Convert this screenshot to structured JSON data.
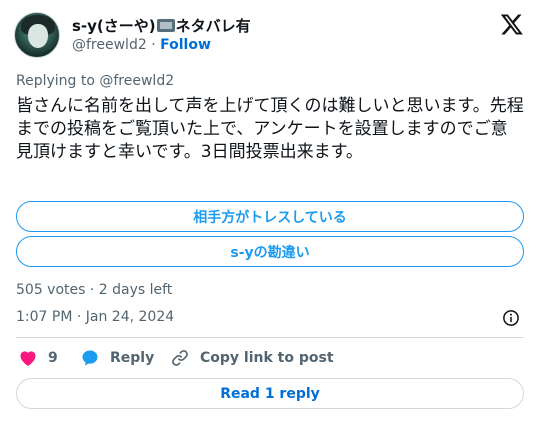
{
  "tweet": {
    "display_name": "s-y(さーや)",
    "display_name_suffix": "ネタバレ有",
    "handle": "@freewld2",
    "separator": "·",
    "follow_label": "Follow",
    "replying_to": "Replying to @freewld2",
    "text": "皆さんに名前を出して声を上げて頂くのは難しいと思います。先程までの投稿をご覧頂いた上で、アンケートを設置しますのでご意見頂けますと幸いです。3日間投票出来ます。",
    "poll": {
      "options": [
        "相手方がトレスしている",
        "s-yの勘違い"
      ],
      "meta": "505 votes · 2 days left"
    },
    "timestamp": "1:07 PM · Jan 24, 2024",
    "actions": {
      "like_count": "9",
      "reply_label": "Reply",
      "copy_label": "Copy link to post"
    },
    "read_replies_label": "Read 1 reply"
  },
  "colors": {
    "accent": "#1d9bf0",
    "link": "#006fd6",
    "like": "#f91880",
    "muted": "#536471",
    "border": "#cfd9de"
  },
  "icons": [
    "avatar",
    "tv-emoji",
    "x-logo-icon",
    "info-icon",
    "heart-icon",
    "reply-bubble-icon",
    "link-icon"
  ]
}
